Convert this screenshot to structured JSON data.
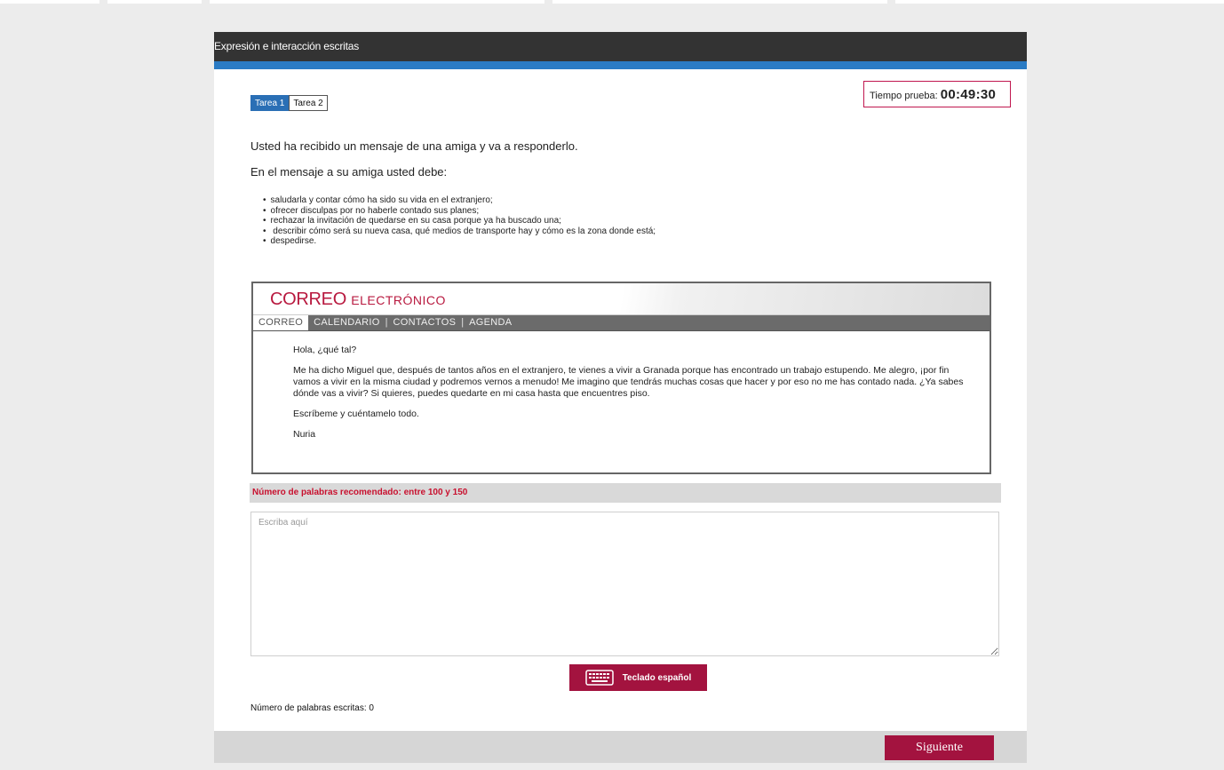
{
  "header": {
    "title": "Expresión e interacción escritas"
  },
  "tabs": [
    {
      "label": "Tarea 1",
      "active": true
    },
    {
      "label": "Tarea 2",
      "active": false
    }
  ],
  "timer": {
    "label": "Tiempo prueba:",
    "value": "00:49:30"
  },
  "instructions": {
    "line1": "Usted ha recibido un mensaje de una amiga y va a responderlo.",
    "line2": "En el mensaje a su amiga usted debe:",
    "bullets": [
      "saludarla y contar cómo ha sido su vida en el extranjero;",
      "ofrecer disculpas por no haberle contado sus planes;",
      "rechazar la invitación de quedarse en su casa porque ya ha buscado una;",
      " describir cómo será su nueva casa, qué medios de transporte hay y cómo es la zona donde está;",
      "despedirse."
    ]
  },
  "mail": {
    "title_big": "CORREO",
    "title_small": "ELECTRÓNICO",
    "nav": [
      "CORREO",
      "CALENDARIO",
      "CONTACTOS",
      "AGENDA"
    ],
    "greeting": "Hola, ¿qué tal?",
    "paragraph": "Me ha dicho Miguel que, después de tantos años en el extranjero, te vienes a vivir a Granada porque has encontrado un trabajo estupendo. Me alegro, ¡por fin vamos a vivir en la misma ciudad y podremos vernos a menudo! Me imagino que tendrás muchas cosas que hacer y por eso no me has contado nada. ¿Ya sabes dónde vas a vivir? Si quieres, puedes quedarte en mi casa hasta que encuentres piso.",
    "closing": "Escríbeme y cuéntamelo todo.",
    "signature": "Nuria"
  },
  "word_recommendation": "Número de palabras recomendado: entre 100 y 150",
  "answer": {
    "placeholder": "Escriba aquí",
    "value": ""
  },
  "keyboard_button": {
    "label": "Teclado español",
    "icon": "keyboard-icon"
  },
  "word_count": {
    "label": "Número de palabras escritas:",
    "value": "0"
  },
  "next_button": {
    "label": "Siguiente"
  },
  "colors": {
    "accent_blue": "#2a7bc4",
    "brand_red": "#a3133f",
    "header_dark": "#333333"
  }
}
